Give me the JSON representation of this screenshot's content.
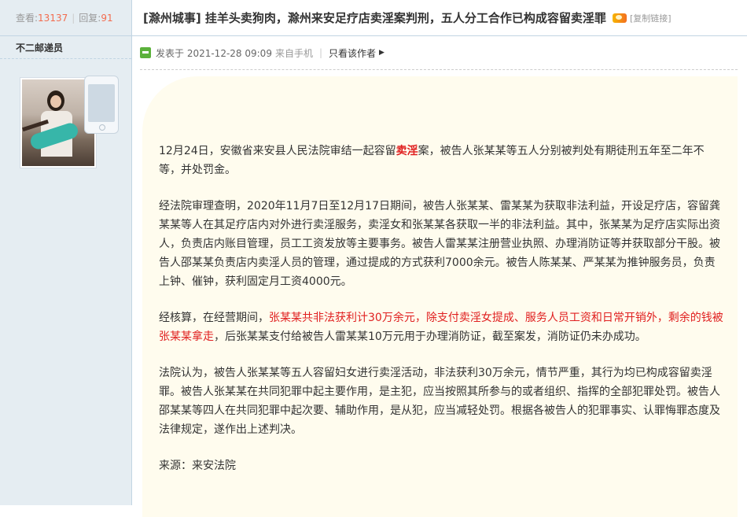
{
  "stats": {
    "view_label": "查看:",
    "view_count": "13137",
    "reply_label": "回复:",
    "reply_count": "91"
  },
  "user": {
    "name": "不二邮递员"
  },
  "thread": {
    "title": "[滁州城事] 挂羊头卖狗肉，滁州来安足疗店卖淫案判刑，五人分工合作已构成容留卖淫罪",
    "copy_link": "[复制链接]"
  },
  "post_meta": {
    "posted": "发表于 2021-12-28 09:09",
    "via": "来自手机",
    "only_author": "只看该作者"
  },
  "paragraphs": {
    "p1_a": "12月24日，安徽省来安县人民法院审结一起容留",
    "p1_hl": "卖淫",
    "p1_b": "案，被告人张某某等五人分别被判处有期徒刑五年至二年不等，并处罚金。",
    "p2": "经法院审理查明，2020年11月7日至12月17日期间，被告人张某某、雷某某为获取非法利益，开设足疗店，容留龚某某等人在其足疗店内对外进行卖淫服务，卖淫女和张某某各获取一半的非法利益。其中，张某某为足疗店实际出资人，负责店内账目管理，员工工资发放等主要事务。被告人雷某某注册营业执照、办理消防证等并获取部分干股。被告人邵某某负责店内卖淫人员的管理，通过提成的方式获利7000余元。被告人陈某某、严某某为推钟服务员，负责上钟、催钟，获利固定月工资4000元。",
    "p3_a": "经核算，在经营期间，",
    "p3_red": "张某某共非法获利计30万余元，除支付卖淫女提成、服务人员工资和日常开销外，剩余的钱被张某某拿走",
    "p3_b": "，后张某某支付给被告人雷某某10万元用于办理消防证，截至案发，消防证仍未办成功。",
    "p4": "法院认为，被告人张某某等五人容留妇女进行卖淫活动，非法获利30万余元，情节严重，其行为均已构成容留卖淫罪。被告人张某某在共同犯罪中起主要作用，是主犯，应当按照其所参与的或者组织、指挥的全部犯罪处罚。被告人邵某某等四人在共同犯罪中起次要、辅助作用，是从犯，应当减轻处罚。根据各被告人的犯罪事实、认罪悔罪态度及法律规定，遂作出上述判决。",
    "source": "来源：来安法院"
  },
  "colors": {
    "sidebar_bg": "#e5edf2",
    "content_bg": "#fffcee",
    "highlight": "#e02020",
    "count": "#f26c4f"
  },
  "icons": [
    "hot-icon",
    "online-status-icon",
    "mobile-phone-icon",
    "apple-icon",
    "dropdown-triangle-icon"
  ]
}
